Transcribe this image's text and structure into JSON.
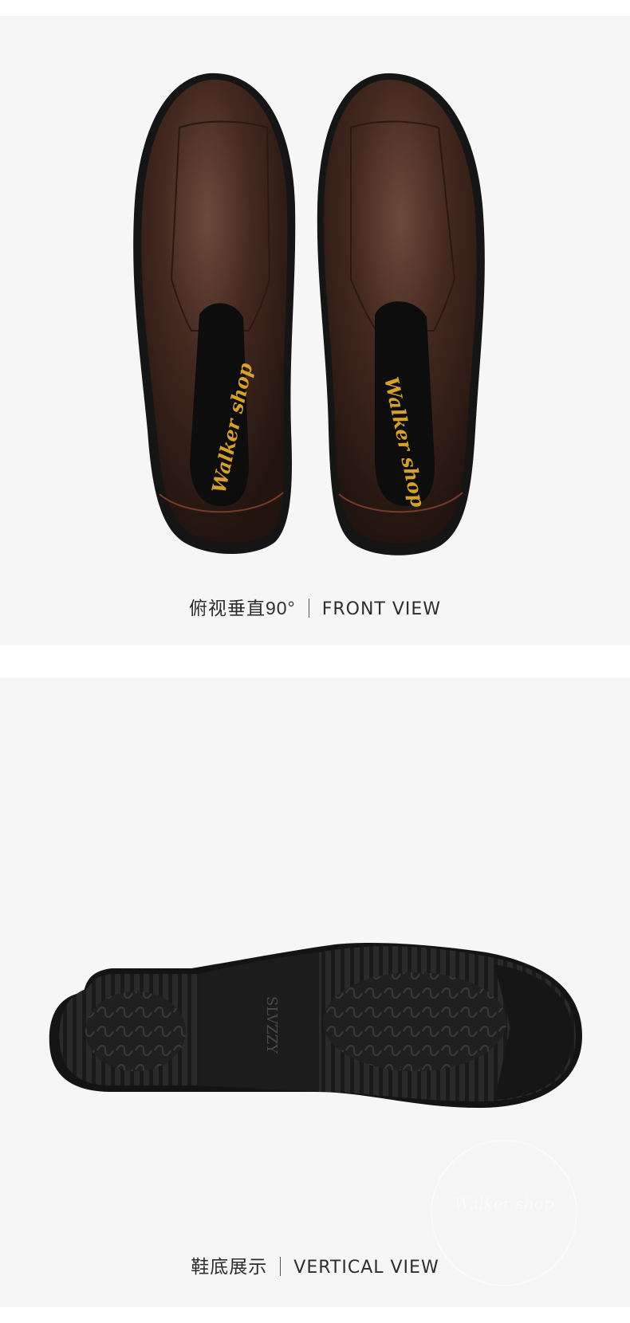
{
  "front_view": {
    "caption_cn": "俯视垂直90°",
    "caption_en": "FRONT  VIEW",
    "insole_brand": "Walker shop"
  },
  "sole_view": {
    "caption_cn": "鞋底展示",
    "caption_en": "VERTICAL  VIEW",
    "sole_brand": "SLVZZY",
    "watermark": "Walker shop"
  },
  "colors": {
    "leather": "#3b241c",
    "leather_highlight": "#6a4638",
    "outsole": "#1c1c1c",
    "insole_logo": "#d6a02a",
    "background": "#f6f6f6"
  }
}
